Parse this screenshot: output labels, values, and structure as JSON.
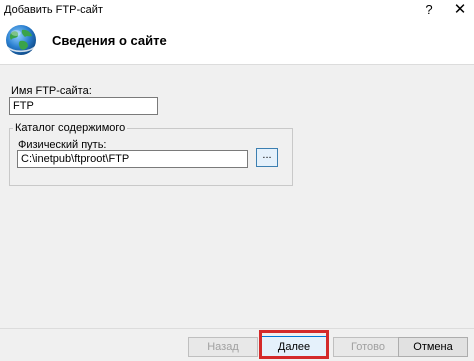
{
  "window": {
    "title": "Добавить FTP-сайт",
    "help_glyph": "?",
    "close_glyph": "✕"
  },
  "header": {
    "heading": "Сведения о сайте",
    "icon": "globe-icon"
  },
  "form": {
    "site_name_label": "Имя FTP-сайта:",
    "site_name_value": "FTP",
    "content_dir_legend": "Каталог содержимого",
    "physical_path_label": "Физический путь:",
    "physical_path_value": "C:\\inetpub\\ftproot\\FTP",
    "browse_label": "..."
  },
  "buttons": {
    "back": "Назад",
    "next": "Далее",
    "finish": "Готово",
    "cancel": "Отмена"
  },
  "colors": {
    "highlight": "#d42a2a",
    "accent": "#0078d7"
  }
}
